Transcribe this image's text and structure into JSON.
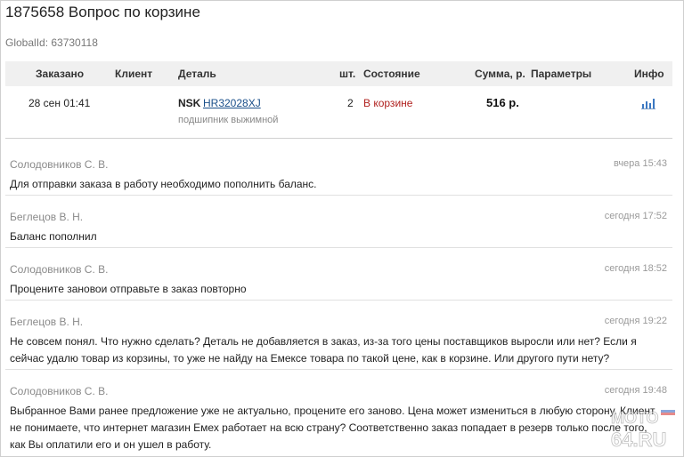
{
  "page": {
    "title": "1875658 Вопрос по корзине",
    "global_id": "GlobalId: 63730118"
  },
  "order_table": {
    "headers": {
      "ordered": "Заказано",
      "client": "Клиент",
      "part": "Деталь",
      "qty": "шт.",
      "status": "Состояние",
      "sum": "Сумма, р.",
      "params": "Параметры",
      "info": "Инфо"
    },
    "row": {
      "ordered": "28 сен 01:41",
      "client": "",
      "brand": "NSK",
      "part_number": "HR32028XJ",
      "part_desc": "подшипник выжимной",
      "qty": "2",
      "status": "В корзине",
      "sum": "516 р.",
      "params": "",
      "info_icon": "chart-icon"
    }
  },
  "messages": [
    {
      "author": "Солодовников С. В.",
      "time": "вчера 15:43",
      "text": "Для отправки заказа в работу необходимо пополнить баланс."
    },
    {
      "author": "Беглецов В. Н.",
      "time": "сегодня 17:52",
      "text": "Баланс пополнил"
    },
    {
      "author": "Солодовников С. В.",
      "time": "сегодня 18:52",
      "text": "Проценитe занoвои отправьте в заказ повторно"
    },
    {
      "author": "Беглецов В. Н.",
      "time": "сегодня 19:22",
      "text": "Не совсем понял. Что нужно сделать? Деталь не добавляется в заказ, из-за того цены поставщиков выросли или нет? Если я сейчас удалю товар из корзины, то уже не найду на Емексе товара по такой цене, как в корзине. Или другого пути нету?"
    },
    {
      "author": "Солодовников С. В.",
      "time": "сегодня 19:48",
      "text": "Выбранное Вами ранее предложение уже не актуально, процените его заново. Цена может измениться в любую сторону. Клиент не понимаете, что интернет магазин Емех работает на всю страну? Соответственно заказ попадает в резерв только после того, как Вы оплатили его и он ушел в работу."
    }
  ],
  "watermark": {
    "line1": "МОТО",
    "line2": "64.RU"
  },
  "colors": {
    "header_bg": "#f0f0f0",
    "status_red": "#b0201e",
    "link_blue": "#1a4f8a"
  }
}
